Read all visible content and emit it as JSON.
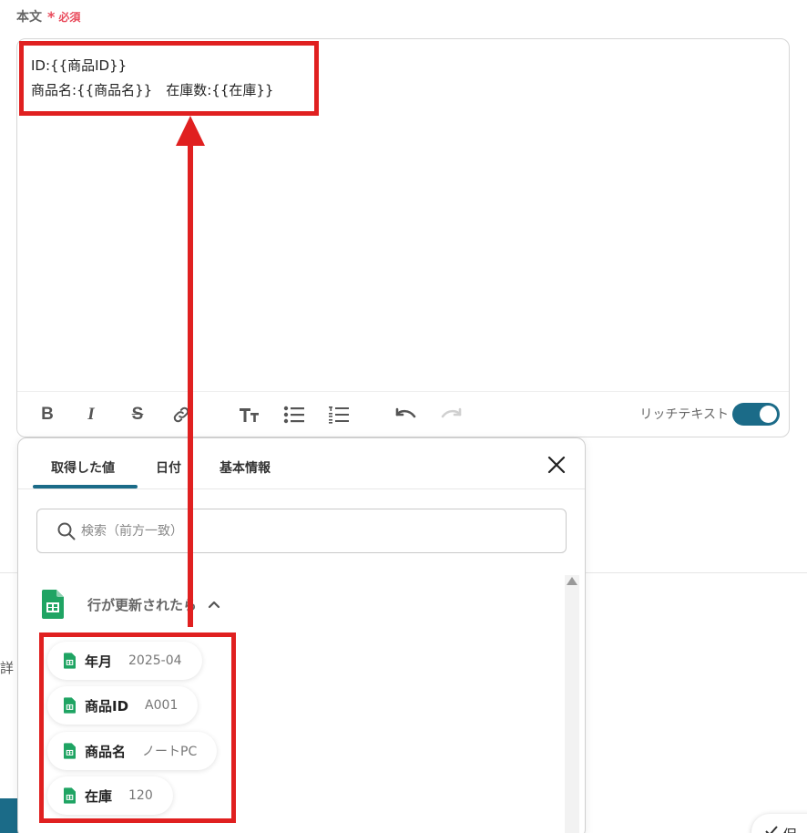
{
  "field": {
    "label": "本文",
    "required_mark": "*",
    "required_text": "必須"
  },
  "editor": {
    "lines": [
      "ID:{{商品ID}}",
      "商品名:{{商品名}}　在庫数:{{在庫}}"
    ],
    "toolbar": {
      "bold": "B",
      "italic": "I",
      "strike": "S",
      "rich_text_label": "リッチテキスト",
      "rich_text_enabled": true
    }
  },
  "popup": {
    "tabs": [
      {
        "label": "取得した値",
        "active": true
      },
      {
        "label": "日付",
        "active": false
      },
      {
        "label": "基本情報",
        "active": false
      }
    ],
    "search": {
      "placeholder": "検索（前方一致）",
      "value": ""
    },
    "section": {
      "title": "行が更新されたら",
      "expanded": true
    },
    "items": [
      {
        "name": "年月",
        "value": "2025-04"
      },
      {
        "name": "商品ID",
        "value": "A001"
      },
      {
        "name": "商品名",
        "value": "ノートPC"
      },
      {
        "name": "在庫",
        "value": "120"
      }
    ]
  },
  "background": {
    "partial_text": "詳",
    "save_label": "保"
  },
  "colors": {
    "accent": "#1b6b88",
    "required": "#e94b5c",
    "annotation": "#e02020",
    "sheets_green": "#1fa463"
  }
}
